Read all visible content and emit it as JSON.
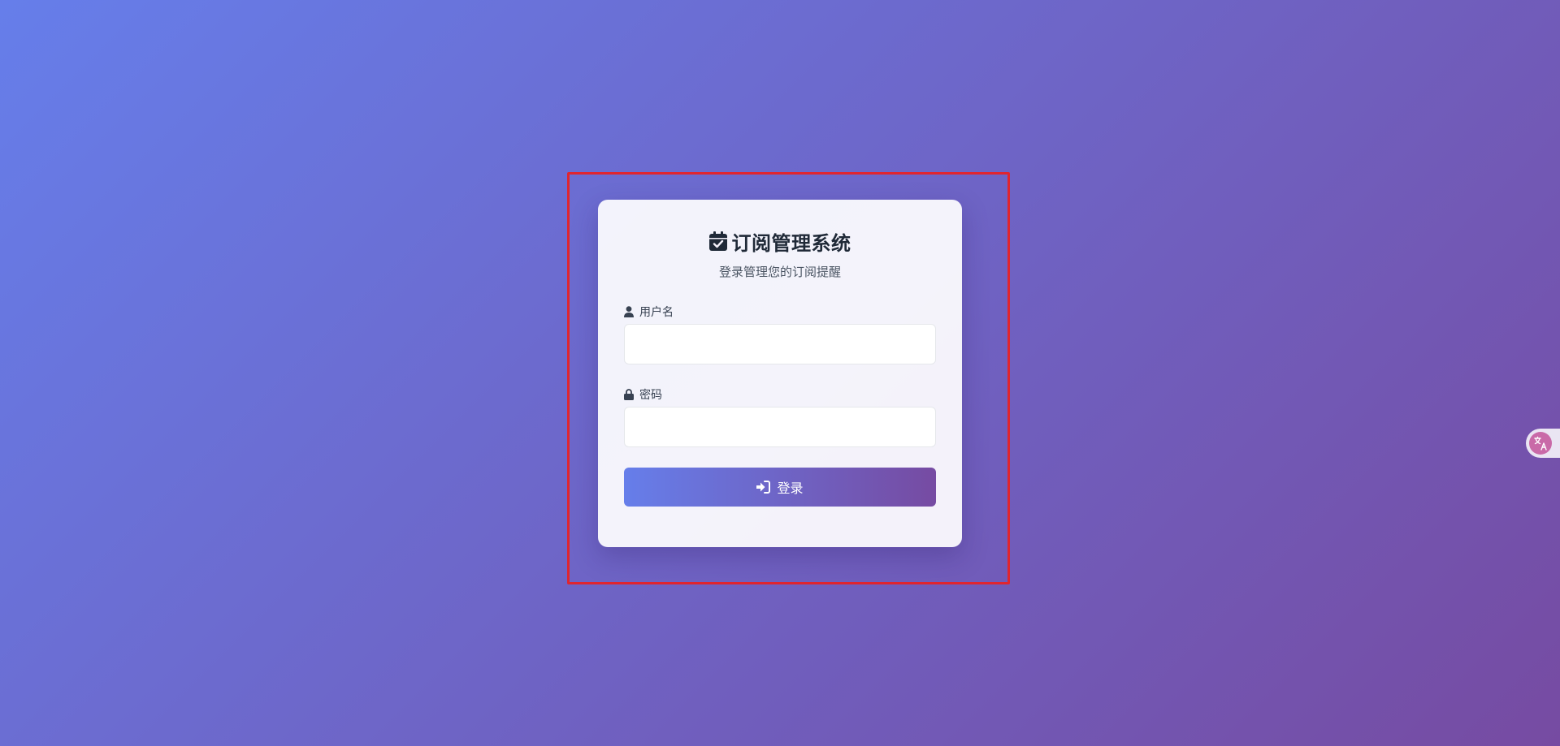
{
  "header": {
    "title": "订阅管理系统",
    "subtitle": "登录管理您的订阅提醒"
  },
  "form": {
    "username_label": "用户名",
    "username_value": "",
    "password_label": "密码",
    "password_value": "",
    "login_label": "登录"
  },
  "icons": {
    "title": "calendar-check-icon",
    "username": "user-icon",
    "password": "lock-icon",
    "login": "sign-in-icon",
    "translate": "translate-icon"
  },
  "colors": {
    "gradient_start": "#667eea",
    "gradient_end": "#764ba2",
    "highlight": "#e0252f"
  }
}
